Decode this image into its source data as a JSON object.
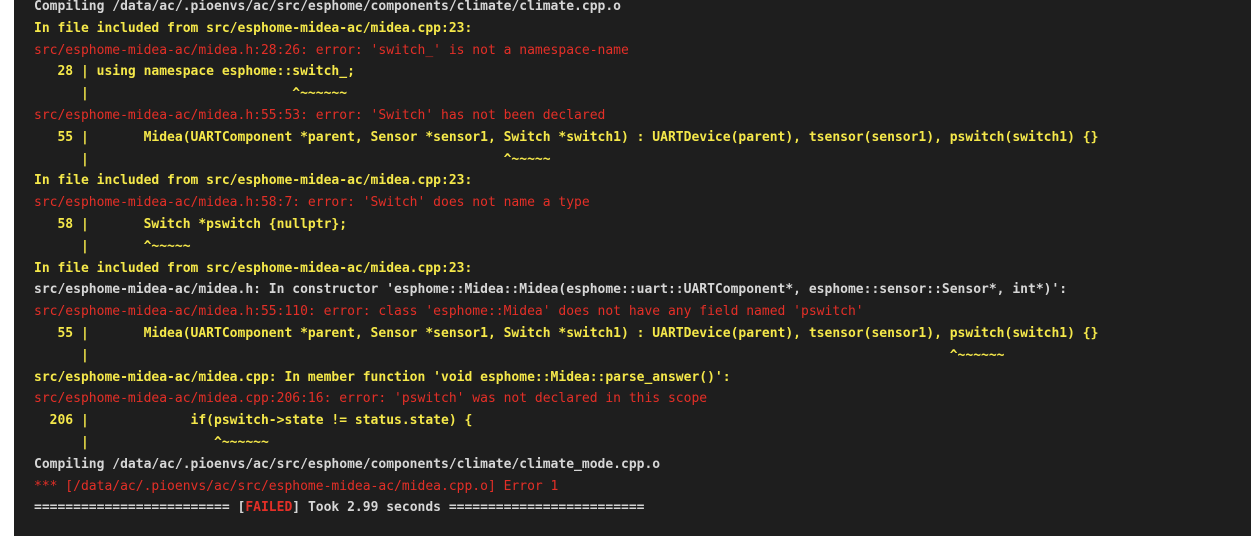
{
  "colors": {
    "background": "#1e1e1e",
    "white": "#d6d6d6",
    "yellow": "#f5e84a",
    "red": "#e42f27"
  },
  "lines": [
    "Compiling /data/ac/.pioenvs/ac/src/esphome/components/climate/climate.cpp.o",
    "In file included from src/esphome-midea-ac/midea.cpp:23:",
    "src/esphome-midea-ac/midea.h:28:26: error: 'switch_' is not a namespace-name",
    "   28 | using namespace esphome::switch_;",
    "      |                          ^~~~~~~",
    "src/esphome-midea-ac/midea.h:55:53: error: 'Switch' has not been declared",
    "   55 |       Midea(UARTComponent *parent, Sensor *sensor1, Switch *switch1) : UARTDevice(parent), tsensor(sensor1), pswitch(switch1) {}",
    "      |                                                     ^~~~~~",
    "In file included from src/esphome-midea-ac/midea.cpp:23:",
    "src/esphome-midea-ac/midea.h:58:7: error: 'Switch' does not name a type",
    "   58 |       Switch *pswitch {nullptr};",
    "      |       ^~~~~~",
    "In file included from src/esphome-midea-ac/midea.cpp:23:",
    "src/esphome-midea-ac/midea.h: In constructor 'esphome::Midea::Midea(esphome::uart::UARTComponent*, esphome::sensor::Sensor*, int*)':",
    "src/esphome-midea-ac/midea.h:55:110: error: class 'esphome::Midea' does not have any field named 'pswitch'",
    "   55 |       Midea(UARTComponent *parent, Sensor *sensor1, Switch *switch1) : UARTDevice(parent), tsensor(sensor1), pswitch(switch1) {}",
    "      |                                                                                                              ^~~~~~~",
    "src/esphome-midea-ac/midea.cpp: In member function 'void esphome::Midea::parse_answer()':",
    "src/esphome-midea-ac/midea.cpp:206:16: error: 'pswitch' was not declared in this scope",
    "  206 |             if(pswitch->state != status.state) {",
    "      |                ^~~~~~~",
    "Compiling /data/ac/.pioenvs/ac/src/esphome/components/climate/climate_mode.cpp.o",
    "*** [/data/ac/.pioenvs/ac/src/esphome-midea-ac/midea.cpp.o] Error 1"
  ],
  "status_line": {
    "prefix": "========================= [",
    "failed": "FAILED",
    "suffix": "] Took 2.99 seconds ========================="
  }
}
